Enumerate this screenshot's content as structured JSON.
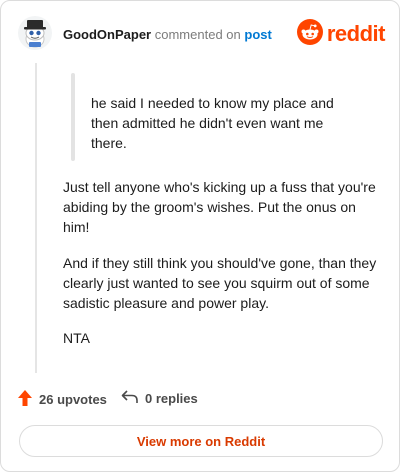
{
  "header": {
    "username": "GoodOnPaper",
    "action": "commented on",
    "post_link": "post",
    "brand": "reddit"
  },
  "comment": {
    "quote": "he said I needed to know my place and then admitted he didn't even want me there.",
    "paragraphs": [
      "Just tell anyone who's kicking up a fuss that you're abiding by the groom's wishes. Put the onus on him!",
      "And if they still think you should've gone, than they clearly just wanted to see you squirm out of some sadistic pleasure and power play.",
      "NTA"
    ]
  },
  "footer": {
    "upvotes": "26 upvotes",
    "replies": "0 replies",
    "view_more": "View more on Reddit"
  },
  "colors": {
    "brand": "#ff4500",
    "link": "#0079d3",
    "upvote": "#ff4500",
    "view_more": "#d93a00"
  },
  "icons": {
    "avatar": "snoo-avatar-icon",
    "brand": "reddit-logo-icon",
    "upvote": "upvote-arrow-icon",
    "reply": "reply-arrow-icon"
  }
}
